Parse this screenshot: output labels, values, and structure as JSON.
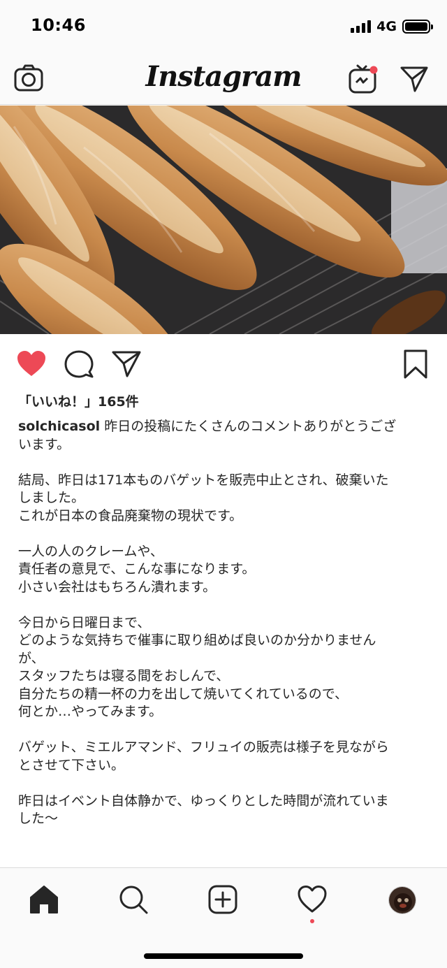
{
  "status_bar": {
    "time": "10:46",
    "network": "4G",
    "signal_bars": 4,
    "battery_level": 1.0
  },
  "header": {
    "logo": "Instagram",
    "igtv_notification": true,
    "icons": [
      "camera-icon",
      "igtv-icon",
      "direct-message-icon"
    ]
  },
  "post": {
    "liked": true,
    "likes_text": "「いいね！」165件",
    "action_icons": [
      "heart-icon",
      "comment-icon",
      "share-icon",
      "bookmark-icon"
    ],
    "username": "solchicasol",
    "caption_lines": [
      "昨日の投稿にたくさんのコメントありがとうござ",
      "います。",
      "",
      "結局、昨日は171本ものバゲットを販売中止とされ、破棄いた",
      "しました。",
      "これが日本の食品廃棄物の現状です。",
      "",
      "一人の人のクレームや、",
      "責任者の意見で、こんな事になります。",
      "小さい会社はもちろん潰れます。",
      "",
      "今日から日曜日まで、",
      "どのような気持ちで催事に取り組めば良いのか分かりません",
      "が、",
      "スタッフたちは寝る間をおしんで、",
      "自分たちの精一杯の力を出して焼いてくれているので、",
      "何とか…やってみます。",
      "",
      "バゲット、ミエルアマンド、フリュイの販売は様子を見ながら",
      "とさせて下さい。",
      "",
      "昨日はイベント自体静かで、ゆっくりとした時間が流れていま",
      "した〜"
    ]
  },
  "bottom_nav": {
    "items": [
      "home-icon",
      "search-icon",
      "add-post-icon",
      "activity-icon",
      "profile-avatar"
    ],
    "active": "home",
    "activity_notification": true
  },
  "colors": {
    "like_red": "#ed4956",
    "text": "#262626",
    "bar_background": "#fafafa",
    "border": "#dbdbdb"
  }
}
